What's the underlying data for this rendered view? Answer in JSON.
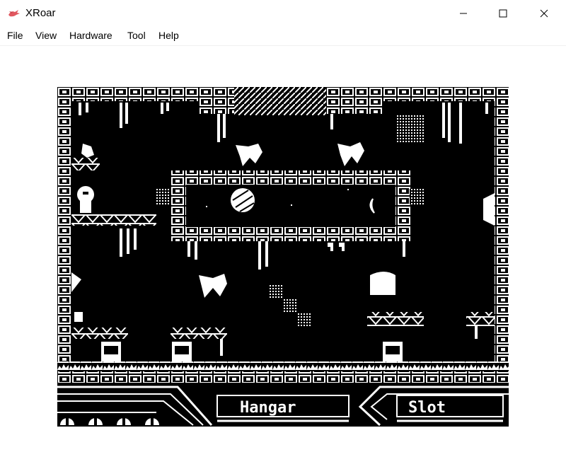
{
  "window": {
    "title": "XRoar",
    "app_icon": "xroar-dragon-icon",
    "controls": [
      "minimize-icon",
      "maximize-icon",
      "close-icon"
    ]
  },
  "menu": {
    "file": "File",
    "view": "View",
    "hardware": "Hardware",
    "tool": "Tool",
    "help": "Help"
  },
  "game": {
    "room_name": "Hangar",
    "slot_label": "Slot",
    "lives_icons": 4,
    "colors": {
      "background": "#000000",
      "foreground": "#ffffff"
    }
  }
}
